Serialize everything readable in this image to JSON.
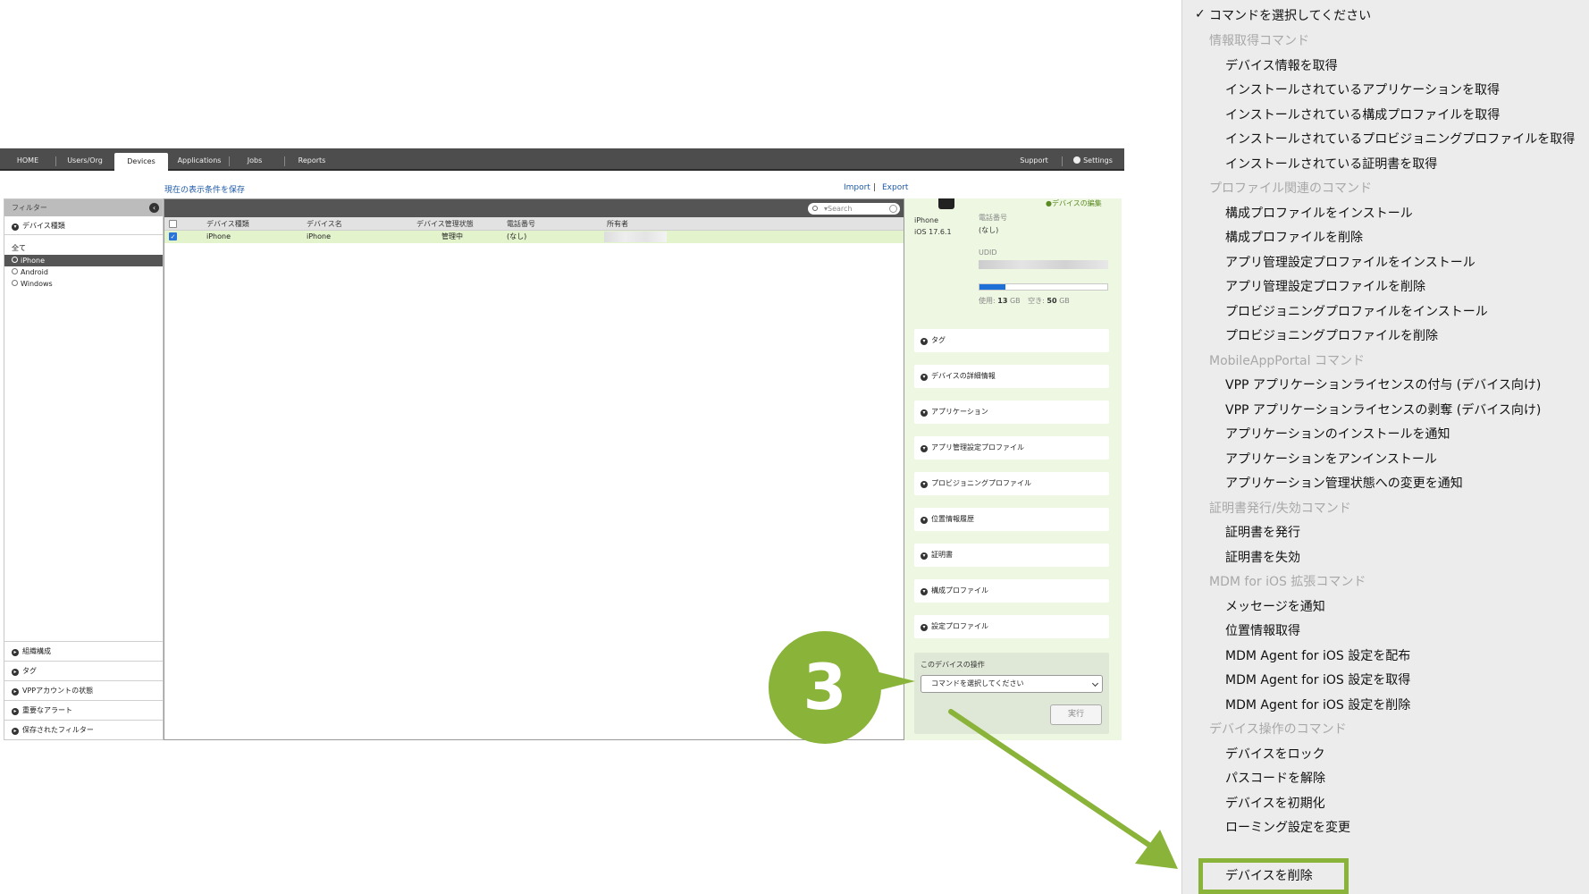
{
  "nav": {
    "tabs": [
      "HOME",
      "Users/Org",
      "Devices",
      "Applications",
      "Jobs",
      "Reports"
    ],
    "support": "Support",
    "settings": "Settings"
  },
  "links": {
    "save_view": "現在の表示条件を保存",
    "import": "Import",
    "separator": "|",
    "export": "Export"
  },
  "filter": {
    "title": "フィルター",
    "device_type_section": "デバイス種類",
    "options": [
      "全て",
      "iPhone",
      "Android",
      "Windows"
    ],
    "selected": "iPhone",
    "bottom_sections": [
      "組織構成",
      "タグ",
      "VPPアカウントの状態",
      "重要なアラート",
      "保存されたフィルター"
    ]
  },
  "grid": {
    "search_placeholder": "▾Search",
    "columns": [
      "デバイス種類",
      "デバイス名",
      "デバイス管理状態",
      "電話番号",
      "所有者"
    ],
    "rows": [
      {
        "type": "iPhone",
        "name": "iPhone",
        "status": "管理中",
        "phone": "(なし)",
        "owner": ""
      }
    ]
  },
  "detail": {
    "edit_link": "デバイスの編集",
    "model": "iPhone",
    "os": "iOS 17.6.1",
    "phone_label": "電話番号",
    "phone_value": "(なし)",
    "udid_label": "UDID",
    "storage": {
      "used_label": "使用:",
      "used_value": "13",
      "free_label": "空き:",
      "free_value": "50",
      "unit": "GB",
      "used_fraction": 0.2
    },
    "sections": [
      "タグ",
      "デバイスの詳細情報",
      "アプリケーション",
      "アプリ管理設定プロファイル",
      "プロビジョニングプロファイル",
      "位置情報履歴",
      "証明書",
      "構成プロファイル",
      "設定プロファイル"
    ],
    "ops_title": "このデバイスの操作",
    "select_value": "コマンドを選択してください",
    "run_button": "実行"
  },
  "callout": {
    "step": "3",
    "color": "#8ab33a"
  },
  "menu": {
    "selected": "コマンドを選択してください",
    "groups": [
      {
        "title": "情報取得コマンド",
        "items": [
          "デバイス情報を取得",
          "インストールされているアプリケーションを取得",
          "インストールされている構成プロファイルを取得",
          "インストールされているプロビジョニングプロファイルを取得",
          "インストールされている証明書を取得"
        ]
      },
      {
        "title": "プロファイル関連のコマンド",
        "items": [
          "構成プロファイルをインストール",
          "構成プロファイルを削除",
          "アプリ管理設定プロファイルをインストール",
          "アプリ管理設定プロファイルを削除",
          "プロビジョニングプロファイルをインストール",
          "プロビジョニングプロファイルを削除"
        ]
      },
      {
        "title": "MobileAppPortal コマンド",
        "items": [
          "VPP アプリケーションライセンスの付与 (デバイス向け)",
          "VPP アプリケーションライセンスの剥奪 (デバイス向け)",
          "アプリケーションのインストールを通知",
          "アプリケーションをアンインストール",
          "アプリケーション管理状態への変更を通知"
        ]
      },
      {
        "title": "証明書発行/失効コマンド",
        "items": [
          "証明書を発行",
          "証明書を失効"
        ]
      },
      {
        "title": "MDM for iOS 拡張コマンド",
        "items": [
          "メッセージを通知",
          "位置情報取得",
          "MDM Agent for iOS 設定を配布",
          "MDM Agent for iOS 設定を取得",
          "MDM Agent for iOS 設定を削除"
        ]
      },
      {
        "title": "デバイス操作のコマンド",
        "items": [
          "デバイスをロック",
          "パスコードを解除",
          "デバイスを初期化",
          "ローミング設定を変更"
        ]
      }
    ],
    "highlighted": "デバイスを削除"
  }
}
